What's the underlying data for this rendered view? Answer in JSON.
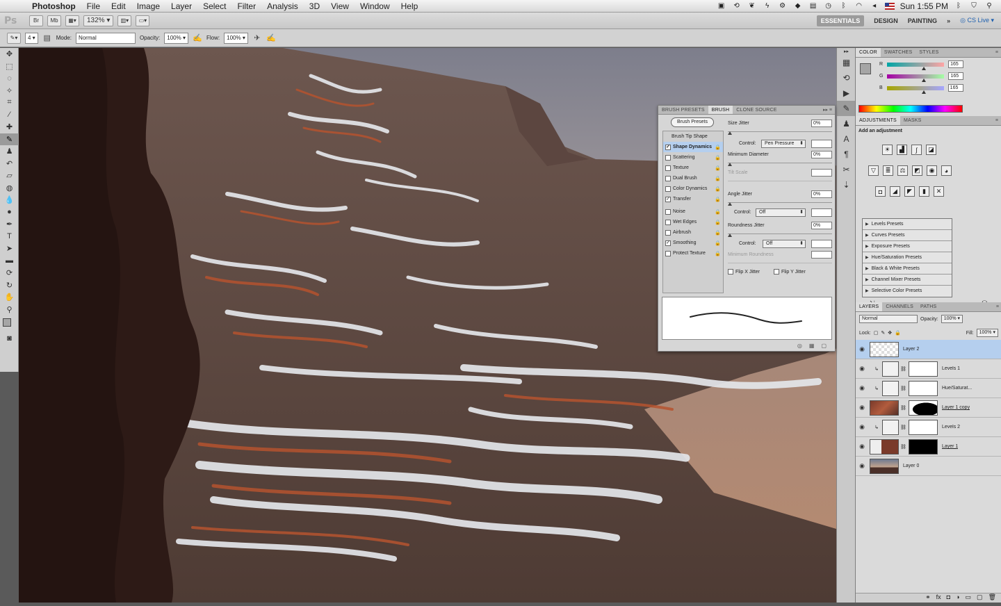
{
  "menubar": {
    "app_name": "Photoshop",
    "items": [
      "File",
      "Edit",
      "Image",
      "Layer",
      "Select",
      "Filter",
      "Analysis",
      "3D",
      "View",
      "Window",
      "Help"
    ],
    "clock": "Sun 1:55 PM"
  },
  "appbar": {
    "logo": "Ps",
    "bridge_btn": "Br",
    "minibridge_btn": "Mb",
    "zoom": "132%",
    "workspaces": [
      "ESSENTIALS",
      "DESIGN",
      "PAINTING"
    ],
    "more": "»",
    "cs_live": "CS Live"
  },
  "options": {
    "brush_size": "4",
    "mode_label": "Mode:",
    "mode_value": "Normal",
    "opacity_label": "Opacity:",
    "opacity_value": "100%",
    "flow_label": "Flow:",
    "flow_value": "100%"
  },
  "color_panel": {
    "tabs": [
      "COLOR",
      "SWATCHES",
      "STYLES"
    ],
    "channels": [
      {
        "label": "R",
        "value": "165"
      },
      {
        "label": "G",
        "value": "165"
      },
      {
        "label": "B",
        "value": "165"
      }
    ],
    "swatch_color": "#a5a5a5"
  },
  "adjustments_panel": {
    "tabs": [
      "ADJUSTMENTS",
      "MASKS"
    ],
    "title": "Add an adjustment",
    "presets": [
      "Levels Presets",
      "Curves Presets",
      "Exposure Presets",
      "Hue/Saturation Presets",
      "Black & White Presets",
      "Channel Mixer Presets",
      "Selective Color Presets"
    ]
  },
  "layers_panel": {
    "tabs": [
      "LAYERS",
      "CHANNELS",
      "PATHS"
    ],
    "blend_mode": "Normal",
    "opacity_label": "Opacity:",
    "opacity_value": "100%",
    "lock_label": "Lock:",
    "fill_label": "Fill:",
    "fill_value": "100%",
    "layers": [
      {
        "name": "Layer 2",
        "selected": true
      },
      {
        "name": "Levels 1"
      },
      {
        "name": "Hue/Saturat..."
      },
      {
        "name": "Layer 1 copy"
      },
      {
        "name": "Levels 2"
      },
      {
        "name": "Layer 1"
      },
      {
        "name": "Layer 0"
      }
    ]
  },
  "brush_panel": {
    "tabs": [
      "BRUSH PRESETS",
      "BRUSH",
      "CLONE SOURCE"
    ],
    "presets_button": "Brush Presets",
    "tip_shape": "Brush Tip Shape",
    "options": [
      {
        "label": "Shape Dynamics",
        "checked": true,
        "selected": true
      },
      {
        "label": "Scattering",
        "checked": false
      },
      {
        "label": "Texture",
        "checked": false
      },
      {
        "label": "Dual Brush",
        "checked": false
      },
      {
        "label": "Color Dynamics",
        "checked": false
      },
      {
        "label": "Transfer",
        "checked": true
      },
      {
        "label": "Noise",
        "checked": false
      },
      {
        "label": "Wet Edges",
        "checked": false
      },
      {
        "label": "Airbrush",
        "checked": false
      },
      {
        "label": "Smoothing",
        "checked": true
      },
      {
        "label": "Protect Texture",
        "checked": false
      }
    ],
    "size_jitter_label": "Size Jitter",
    "size_jitter_value": "0%",
    "control_label": "Control:",
    "control_size": "Pen Pressure",
    "min_diameter_label": "Minimum Diameter",
    "min_diameter_value": "0%",
    "tilt_scale_label": "Tilt Scale",
    "angle_jitter_label": "Angle Jitter",
    "angle_jitter_value": "0%",
    "control_angle": "Off",
    "roundness_jitter_label": "Roundness Jitter",
    "roundness_jitter_value": "0%",
    "control_roundness": "Off",
    "min_roundness_label": "Minimum Roundness",
    "flip_x": "Flip X Jitter",
    "flip_y": "Flip Y Jitter"
  }
}
